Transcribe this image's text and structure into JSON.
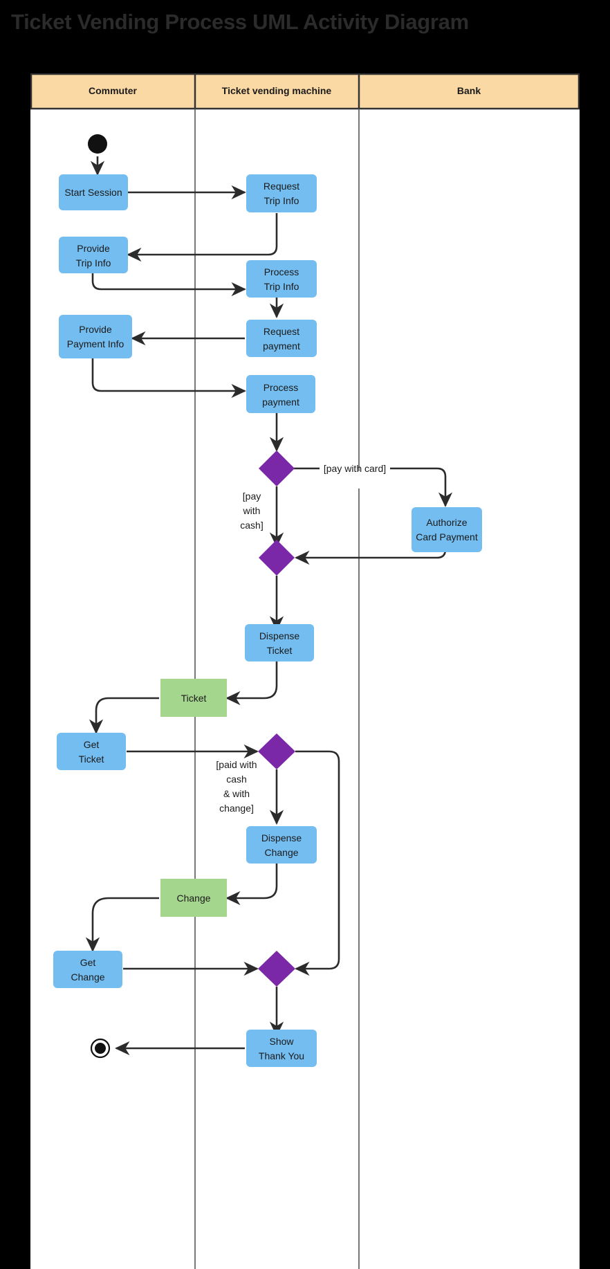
{
  "page": {
    "title": "Ticket Vending Process UML Activity Diagram",
    "background_color": "#000000",
    "canvas_color": "#ffffff"
  },
  "colors": {
    "lane_header_fill": "#fbd9a5",
    "lane_header_stroke": "#333333",
    "action_fill": "#74bdf0",
    "object_fill": "#a5d68d",
    "decision_fill": "#7b28a8",
    "edge_stroke": "#2b2b2b",
    "node_border": "#2b2b2b",
    "text_color": "#1a1a1a"
  },
  "lanes": [
    {
      "id": "commuter",
      "label": "Commuter"
    },
    {
      "id": "tvm",
      "label": "Ticket vending machine"
    },
    {
      "id": "bank",
      "label": "Bank"
    }
  ],
  "nodes": {
    "initial": {
      "type": "initial-node",
      "lane": "commuter"
    },
    "start_session": {
      "type": "action",
      "lane": "commuter",
      "label_lines": [
        "Start Session"
      ]
    },
    "request_trip_info": {
      "type": "action",
      "lane": "tvm",
      "label_lines": [
        "Request",
        "Trip Info"
      ]
    },
    "provide_trip_info": {
      "type": "action",
      "lane": "commuter",
      "label_lines": [
        "Provide",
        "Trip Info"
      ]
    },
    "process_trip_info": {
      "type": "action",
      "lane": "tvm",
      "label_lines": [
        "Process",
        "Trip Info"
      ]
    },
    "request_payment": {
      "type": "action",
      "lane": "tvm",
      "label_lines": [
        "Request",
        "payment"
      ]
    },
    "provide_payment_info": {
      "type": "action",
      "lane": "commuter",
      "label_lines": [
        "Provide",
        "Payment Info"
      ]
    },
    "process_payment": {
      "type": "action",
      "lane": "tvm",
      "label_lines": [
        "Process",
        "payment"
      ]
    },
    "decision_payment_type": {
      "type": "decision",
      "lane": "tvm"
    },
    "authorize_card_payment": {
      "type": "action",
      "lane": "bank",
      "label_lines": [
        "Authorize",
        "Card Payment"
      ]
    },
    "merge_payment": {
      "type": "merge",
      "lane": "tvm"
    },
    "dispense_ticket": {
      "type": "action",
      "lane": "tvm",
      "label_lines": [
        "Dispense",
        "Ticket"
      ]
    },
    "ticket_object": {
      "type": "object",
      "lane": "boundary",
      "label_lines": [
        "Ticket"
      ]
    },
    "get_ticket": {
      "type": "action",
      "lane": "commuter",
      "label_lines": [
        "Get",
        "Ticket"
      ]
    },
    "decision_change": {
      "type": "decision",
      "lane": "tvm"
    },
    "dispense_change": {
      "type": "action",
      "lane": "tvm",
      "label_lines": [
        "Dispense",
        "Change"
      ]
    },
    "change_object": {
      "type": "object",
      "lane": "boundary",
      "label_lines": [
        "Change"
      ]
    },
    "get_change": {
      "type": "action",
      "lane": "commuter",
      "label_lines": [
        "Get",
        "Change"
      ]
    },
    "merge_final": {
      "type": "merge",
      "lane": "tvm"
    },
    "show_thank_you": {
      "type": "action",
      "lane": "tvm",
      "label_lines": [
        "Show",
        "Thank You"
      ]
    },
    "final": {
      "type": "final-node",
      "lane": "commuter"
    }
  },
  "guards": {
    "pay_with_card": {
      "text": "[pay with card]",
      "lines": [
        "[pay with card]"
      ]
    },
    "pay_with_cash": {
      "text": "[pay with cash]",
      "lines": [
        "[pay",
        "with",
        "cash]"
      ]
    },
    "paid_with_cash_and_change": {
      "text": "[paid with cash & with change]",
      "lines": [
        "[paid with",
        "cash",
        "& with",
        "change]"
      ]
    }
  },
  "edges": [
    {
      "from": "initial",
      "to": "start_session"
    },
    {
      "from": "start_session",
      "to": "request_trip_info"
    },
    {
      "from": "request_trip_info",
      "to": "provide_trip_info"
    },
    {
      "from": "provide_trip_info",
      "to": "process_trip_info"
    },
    {
      "from": "process_trip_info",
      "to": "request_payment"
    },
    {
      "from": "request_payment",
      "to": "provide_payment_info"
    },
    {
      "from": "provide_payment_info",
      "to": "process_payment"
    },
    {
      "from": "process_payment",
      "to": "decision_payment_type"
    },
    {
      "from": "decision_payment_type",
      "to": "authorize_card_payment",
      "guard": "pay_with_card"
    },
    {
      "from": "decision_payment_type",
      "to": "merge_payment",
      "guard": "pay_with_cash"
    },
    {
      "from": "authorize_card_payment",
      "to": "merge_payment"
    },
    {
      "from": "merge_payment",
      "to": "dispense_ticket"
    },
    {
      "from": "dispense_ticket",
      "to": "ticket_object"
    },
    {
      "from": "ticket_object",
      "to": "get_ticket"
    },
    {
      "from": "get_ticket",
      "to": "decision_change"
    },
    {
      "from": "decision_change",
      "to": "dispense_change",
      "guard": "paid_with_cash_and_change"
    },
    {
      "from": "decision_change",
      "to": "merge_final"
    },
    {
      "from": "dispense_change",
      "to": "change_object"
    },
    {
      "from": "change_object",
      "to": "get_change"
    },
    {
      "from": "get_change",
      "to": "merge_final"
    },
    {
      "from": "merge_final",
      "to": "show_thank_you"
    },
    {
      "from": "show_thank_you",
      "to": "final"
    }
  ]
}
